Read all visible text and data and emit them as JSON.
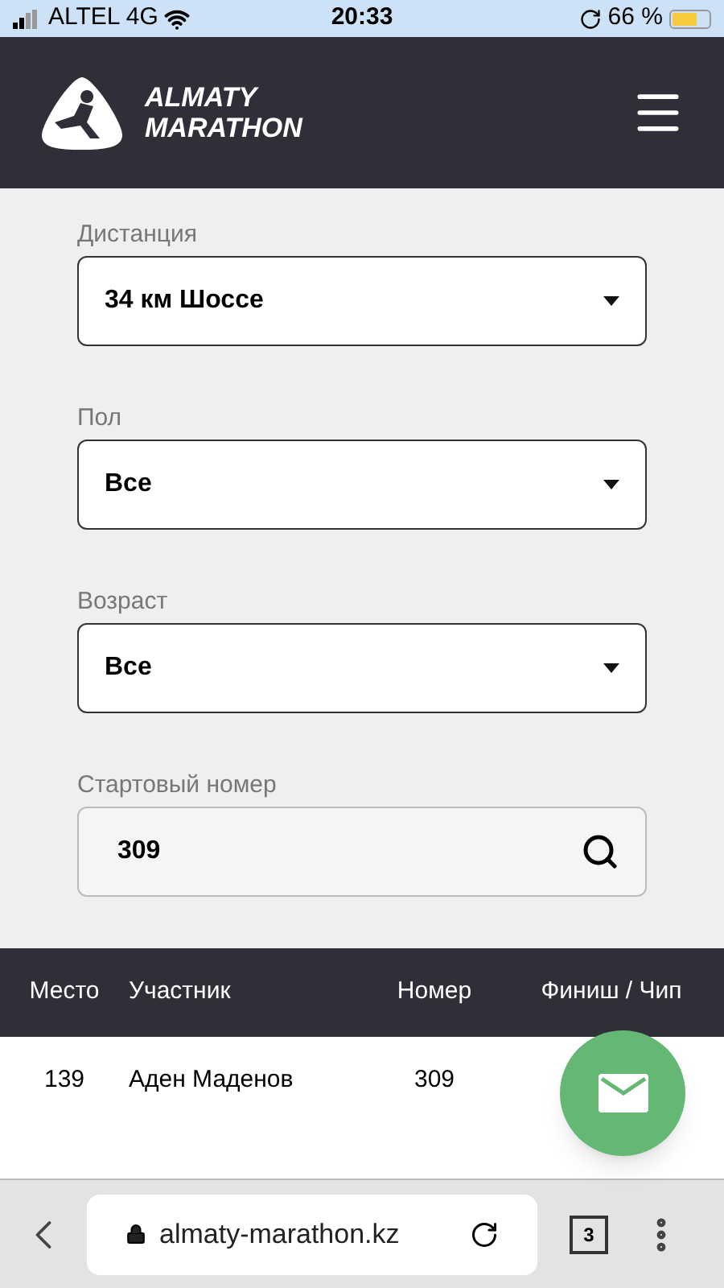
{
  "status_bar": {
    "carrier": "ALTEL 4G",
    "time": "20:33",
    "battery": "66 %"
  },
  "header": {
    "logo_line_1": "ALMATY",
    "logo_line_2": "MARATHON"
  },
  "filters": [
    {
      "kind": "select",
      "label": "Дистанция",
      "value": "34 км Шоссе"
    },
    {
      "kind": "select",
      "label": "Пол",
      "value": "Все"
    },
    {
      "kind": "select",
      "label": "Возраст",
      "value": "Все"
    },
    {
      "kind": "search",
      "label": "Стартовый номер",
      "value": "309"
    }
  ],
  "table": {
    "columns": [
      "Место",
      "Участник",
      "Номер",
      "Финиш / Чип"
    ],
    "rows": [
      [
        "139",
        "Аден Маденов",
        "309"
      ]
    ]
  },
  "browser": {
    "url": "almaty-marathon.kz",
    "tabs_count": "3"
  }
}
